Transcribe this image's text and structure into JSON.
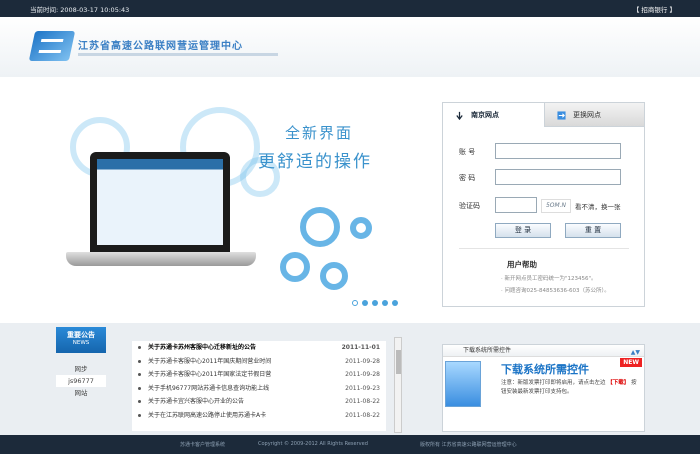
{
  "top_bar": {
    "time_text": "当前时间: 2008-03-17 10:05:43",
    "right_link": "【 招商银行 】"
  },
  "header": {
    "system_title": "江苏省高速公路联网营运管理中心"
  },
  "banner": {
    "slogan_line1": "全新界面",
    "slogan_line2": "更舒适的操作",
    "carousel_dots": 5,
    "active_dot": 0
  },
  "login": {
    "tab_active": "南京网点",
    "tab_inactive": "更换网点",
    "account_label": "账  号",
    "password_label": "密  码",
    "captcha_label": "验证码",
    "account_value": "",
    "password_value": "",
    "captcha_value": "",
    "captcha_image_text": "5OM.N",
    "refresh_text": "看不清，换一张",
    "login_button": "登 录",
    "reset_button": "重 置",
    "help_title": "用户帮助",
    "help_items": [
      "· 新开网点员工密码统一为\"123456\"。",
      "· 问题咨询025-84853636-603（苏公所）。"
    ]
  },
  "notices": {
    "tab_title": "重要公告",
    "tab_subtitle": "NEWS",
    "side_items": [
      "网步",
      "js96777",
      "网站"
    ],
    "selected_side_index": 1,
    "rows": [
      {
        "title": "关于苏通卡苏州客服中心迁移新址的公告",
        "date": "2011-11-01"
      },
      {
        "title": "关于苏通卡客服中心2011年国庆期间营业时间",
        "date": "2011-09-28"
      },
      {
        "title": "关于苏通卡客服中心2011年国家法定节假日营",
        "date": "2011-09-28"
      },
      {
        "title": "关于手机96777网站苏通卡信息查询功能上线",
        "date": "2011-09-23"
      },
      {
        "title": "关于苏通卡宜兴客服中心开业的公告",
        "date": "2011-08-22"
      },
      {
        "title": "关于在江苏联网高速公路停止使用苏通卡A卡",
        "date": "2011-08-22"
      }
    ]
  },
  "download": {
    "header_text": "下载系统所需控件",
    "title": "下载系统所需控件",
    "new_badge": "NEW",
    "desc_text": "注意：新版发票打印即将启用，请点击左边",
    "desc_link": "【下载】",
    "desc_rest": "按钮安装最新发票打印支持包。"
  },
  "footer": {
    "left_text": "苏通卡客户管理系统",
    "copyright": "Copyright © 2009-2012 All Rights Reserved",
    "right_text": "版权所有 江苏省高速公路联网营运管理中心"
  },
  "colors": {
    "topbar": "#1c2a3a",
    "accent": "#3a92cc",
    "notice_tab": "#1565ad"
  }
}
